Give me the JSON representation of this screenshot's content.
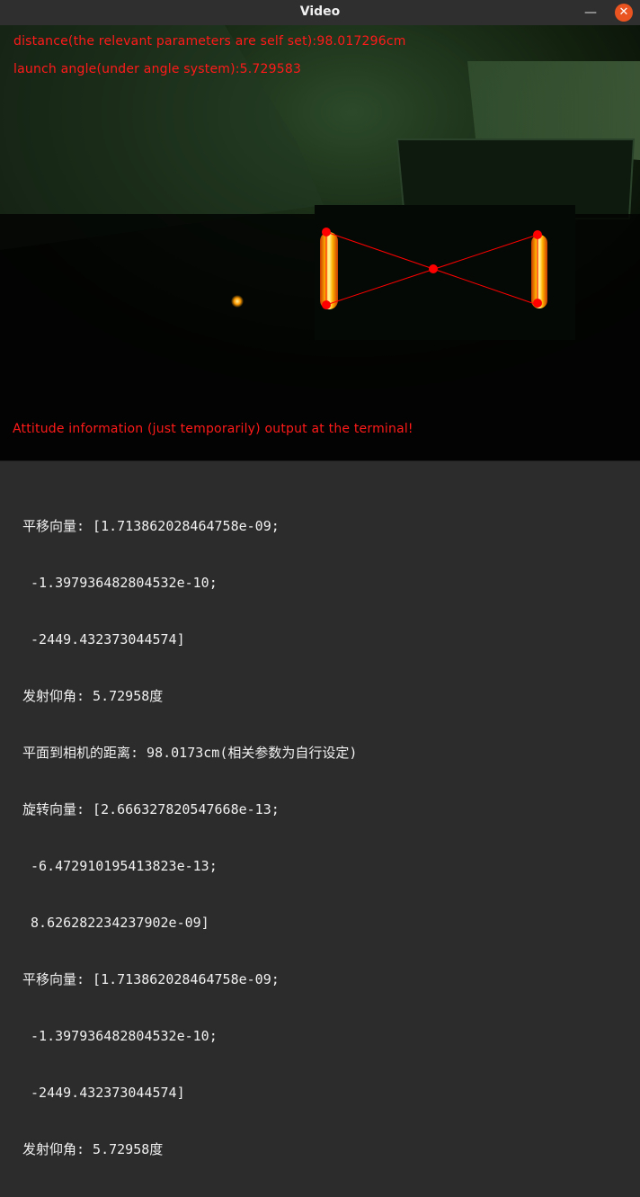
{
  "window": {
    "title": "Video",
    "minimize_glyph": "—",
    "close_glyph": "✕"
  },
  "video": {
    "overlay_top": [
      "distance(the relevant parameters are self set):98.017296cm",
      "launch angle(under angle system):5.729583"
    ],
    "overlay_bottom": "Attitude information (just temporarily) output at the terminal!",
    "annotation_color": "#ff1a1a",
    "marker_color": "#ff0000"
  },
  "terminal": {
    "lines": [
      "平移向量: [1.713862028464758e-09;",
      " -1.397936482804532e-10;",
      " -2449.432373044574]",
      "发射仰角: 5.72958度",
      "平面到相机的距离: 98.0173cm(相关参数为自行设定)",
      "旋转向量: [2.666327820547668e-13;",
      " -6.472910195413823e-13;",
      " 8.626282234237902e-09]",
      "平移向量: [1.713862028464758e-09;",
      " -1.397936482804532e-10;",
      " -2449.432373044574]",
      "发射仰角: 5.72958度"
    ]
  }
}
